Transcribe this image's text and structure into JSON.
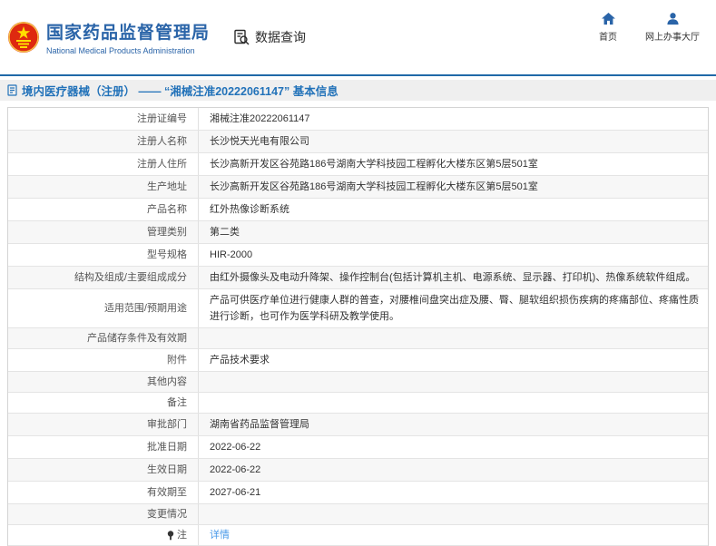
{
  "header": {
    "brand": {
      "title": "国家药品监督管理局",
      "subtitle": "National Medical Products Administration",
      "emblem": "china-national-emblem"
    },
    "data_query": {
      "label": "数据查询",
      "icon": "document-search-icon"
    },
    "nav": [
      {
        "label": "首页",
        "icon": "home-icon"
      },
      {
        "label": "网上办事大厅",
        "icon": "user-icon"
      }
    ]
  },
  "title_bar": {
    "icon": "document-icon",
    "text": "境内医疗器械（注册） —— “湘械注准20222061147” 基本信息"
  },
  "colors": {
    "brand_blue": "#2a64a8",
    "band_text_blue": "#2272b9",
    "link_blue": "#4798e8",
    "header_rule_blue": "#2069a8",
    "stripe_gray": "#f7f7f7",
    "border_gray": "#e0e0e0",
    "emblem_red": "#de2910",
    "emblem_gold": "#ffde00"
  },
  "table": {
    "rows": [
      {
        "label": "注册证编号",
        "value": "湘械注准20222061147"
      },
      {
        "label": "注册人名称",
        "value": "长沙悦天光电有限公司"
      },
      {
        "label": "注册人住所",
        "value": "长沙高新开发区谷苑路186号湖南大学科技园工程孵化大楼东区第5层501室"
      },
      {
        "label": "生产地址",
        "value": "长沙高新开发区谷苑路186号湖南大学科技园工程孵化大楼东区第5层501室"
      },
      {
        "label": "产品名称",
        "value": "红外热像诊断系统"
      },
      {
        "label": "管理类别",
        "value": "第二类"
      },
      {
        "label": "型号规格",
        "value": "HIR-2000"
      },
      {
        "label": "结构及组成/主要组成成分",
        "value": "由红外摄像头及电动升降架、操作控制台(包括计算机主机、电源系统、显示器、打印机)、热像系统软件组成。"
      },
      {
        "label": "适用范围/预期用途",
        "value": "产品可供医疗单位进行健康人群的普查，对腰椎间盘突出症及腰、臀、腿软组织损伤疾病的疼痛部位、疼痛性质进行诊断，也可作为医学科研及教学使用。"
      },
      {
        "label": "产品储存条件及有效期",
        "value": ""
      },
      {
        "label": "附件",
        "value": "产品技术要求"
      },
      {
        "label": "其他内容",
        "value": ""
      },
      {
        "label": "备注",
        "value": ""
      },
      {
        "label": "审批部门",
        "value": "湖南省药品监督管理局"
      },
      {
        "label": "批准日期",
        "value": "2022-06-22"
      },
      {
        "label": "生效日期",
        "value": "2022-06-22"
      },
      {
        "label": "有效期至",
        "value": "2027-06-21"
      },
      {
        "label": "变更情况",
        "value": ""
      },
      {
        "label": "注",
        "value": "详情",
        "value_is_link": true,
        "label_icon": "note-icon"
      }
    ]
  }
}
